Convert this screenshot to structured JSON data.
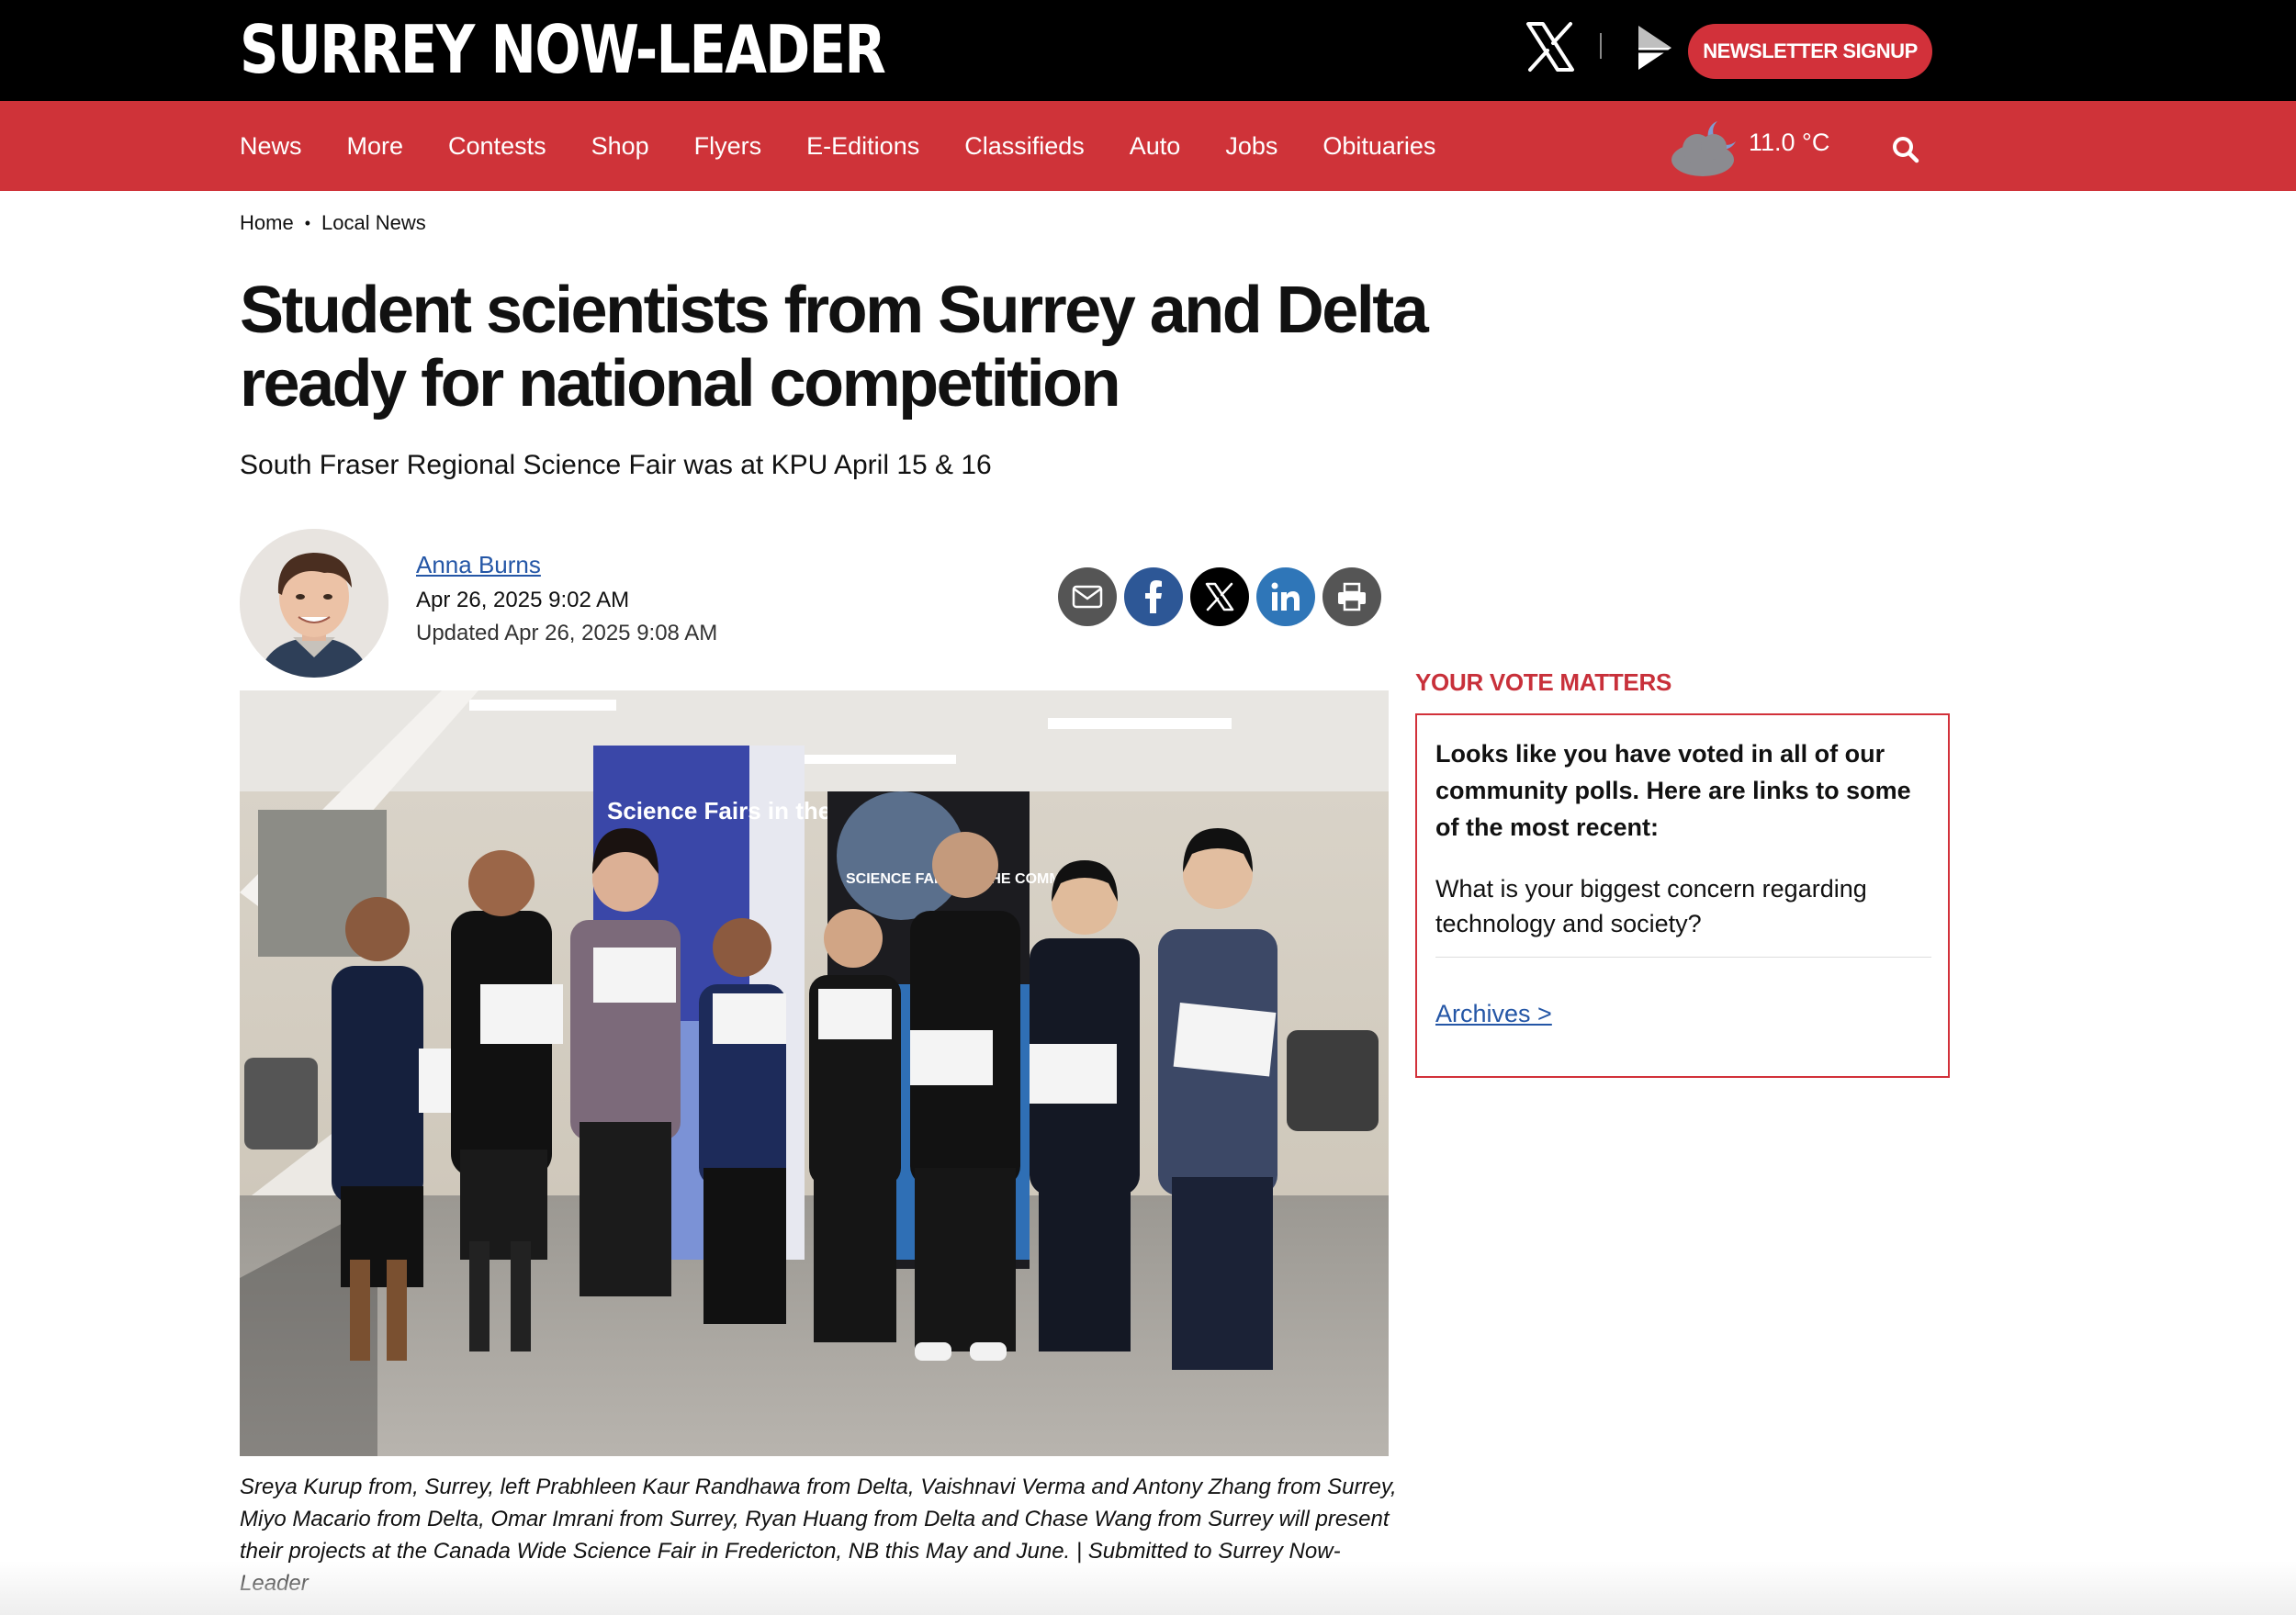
{
  "site": {
    "logo": "SURREY NOW-LEADER",
    "newsletter_label": "NEWSLETTER SIGNUP"
  },
  "nav": {
    "items": [
      "News",
      "More",
      "Contests",
      "Shop",
      "Flyers",
      "E-Editions",
      "Classifieds",
      "Auto",
      "Jobs",
      "Obituaries"
    ],
    "weather": {
      "temp": "11.0 °C",
      "icon": "cloud-moon-icon"
    }
  },
  "breadcrumb": {
    "home": "Home",
    "section": "Local News"
  },
  "article": {
    "headline": "Student scientists from Surrey and Delta ready for national competition",
    "subhead": "South Fraser Regional Science Fair was at KPU April 15 & 16",
    "author": "Anna Burns",
    "published": "Apr 26, 2025 9:02 AM",
    "updated": "Updated Apr 26, 2025 9:08 AM",
    "photo_banner_1": "Science Fairs in the Community",
    "photo_banner_2": "SCIENCE FAIRS IN THE COMMUNITY",
    "caption": "Sreya Kurup from, Surrey, left Prabhleen Kaur Randhawa from Delta, Vaishnavi Verma and Antony Zhang from Surrey, Miyo Macario from Delta, Omar Imrani from Surrey, Ryan Huang from Delta and Chase Wang from Surrey will present their projects at the Canada Wide Science Fair in Fredericton, NB this May and June.  | Submitted to Surrey Now-Leader"
  },
  "share": [
    {
      "name": "email-share",
      "icon": "envelope-icon",
      "color": "#555555"
    },
    {
      "name": "facebook-share",
      "icon": "facebook-icon",
      "color": "#2d5796"
    },
    {
      "name": "x-share",
      "icon": "x-icon",
      "color": "#000000"
    },
    {
      "name": "linkedin-share",
      "icon": "linkedin-icon",
      "color": "#2f76b8"
    },
    {
      "name": "print-share",
      "icon": "printer-icon",
      "color": "#555555"
    }
  ],
  "poll": {
    "heading": "YOUR VOTE MATTERS",
    "intro": "Looks like you have voted in all of our community polls. Here are links to some of the most recent:",
    "question": "What is your biggest concern regarding technology and society?",
    "archives": "Archives >"
  },
  "colors": {
    "brand_red": "#cf3339",
    "link_blue": "#2456a6"
  }
}
